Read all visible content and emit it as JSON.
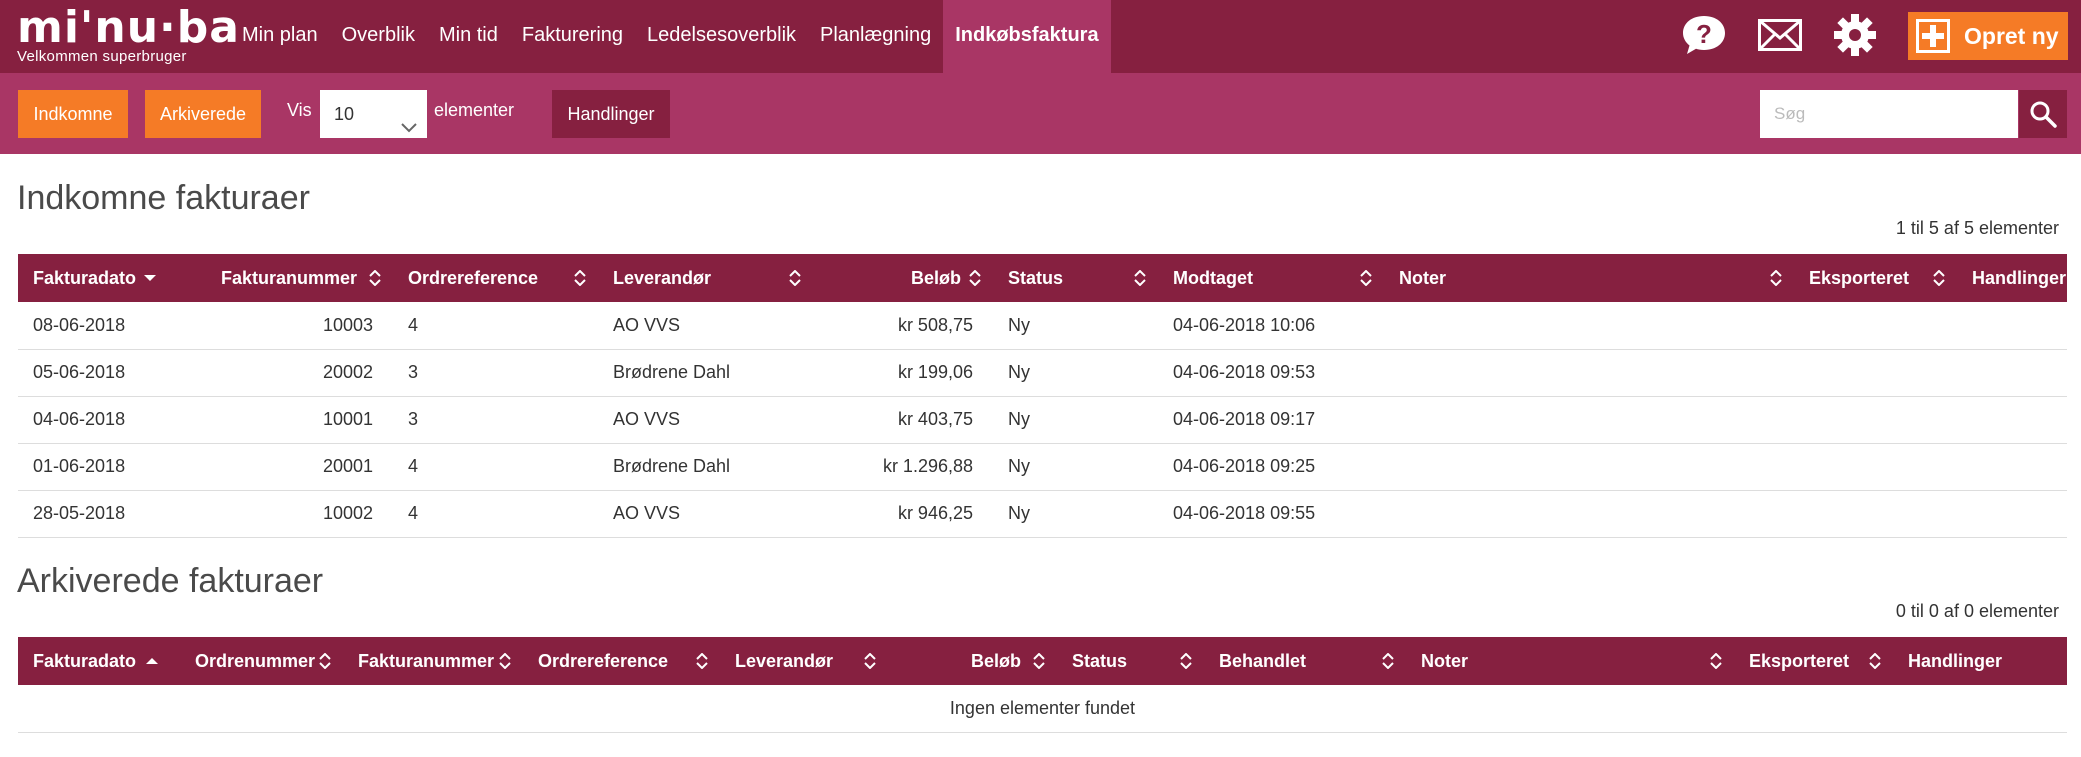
{
  "app": {
    "logo": "mi'nu·ba",
    "welcome": "Velkommen superbruger"
  },
  "nav": [
    {
      "label": "Min plan"
    },
    {
      "label": "Overblik"
    },
    {
      "label": "Min tid"
    },
    {
      "label": "Fakturering"
    },
    {
      "label": "Ledelsesoverblik"
    },
    {
      "label": "Planlægning"
    },
    {
      "label": "Indkøbsfaktura",
      "active": true
    }
  ],
  "top_icons": [
    "help-icon",
    "mail-icon",
    "gear-icon",
    "plus-icon"
  ],
  "create_label": "Opret ny",
  "toolbar": {
    "incoming_label": "Indkomne",
    "archived_label": "Arkiverede",
    "show_label": "Vis",
    "page_size": "10",
    "elements_label": "elementer",
    "actions_label": "Handlinger",
    "search_placeholder": "Søg"
  },
  "colors": {
    "primary": "#862040",
    "secondary": "#a93665",
    "accent": "#f57b26"
  },
  "incoming": {
    "title": "Indkomne fakturaer",
    "count": "1 til 5 af 5 elementer",
    "columns": [
      "Fakturadato",
      "Fakturanummer",
      "Ordrereference",
      "Leverandør",
      "Beløb",
      "Status",
      "Modtaget",
      "Noter",
      "Eksporteret",
      "Handlinger"
    ],
    "rows": [
      [
        "08-06-2018",
        "10003",
        "4",
        "AO VVS",
        "kr 508,75",
        "Ny",
        "04-06-2018 10:06",
        "",
        "",
        ""
      ],
      [
        "05-06-2018",
        "20002",
        "3",
        "Brødrene Dahl",
        "kr 199,06",
        "Ny",
        "04-06-2018 09:53",
        "",
        "",
        ""
      ],
      [
        "04-06-2018",
        "10001",
        "3",
        "AO VVS",
        "kr 403,75",
        "Ny",
        "04-06-2018 09:17",
        "",
        "",
        ""
      ],
      [
        "01-06-2018",
        "20001",
        "4",
        "Brødrene Dahl",
        "kr 1.296,88",
        "Ny",
        "04-06-2018 09:25",
        "",
        "",
        ""
      ],
      [
        "28-05-2018",
        "10002",
        "4",
        "AO VVS",
        "kr 946,25",
        "Ny",
        "04-06-2018 09:55",
        "",
        "",
        ""
      ]
    ]
  },
  "archived": {
    "title": "Arkiverede fakturaer",
    "count": "0 til 0 af 0 elementer",
    "columns": [
      "Fakturadato",
      "Ordrenummer",
      "Fakturanummer",
      "Ordrereference",
      "Leverandør",
      "Beløb",
      "Status",
      "Behandlet",
      "Noter",
      "Eksporteret",
      "Handlinger"
    ],
    "empty": "Ingen elementer fundet"
  }
}
